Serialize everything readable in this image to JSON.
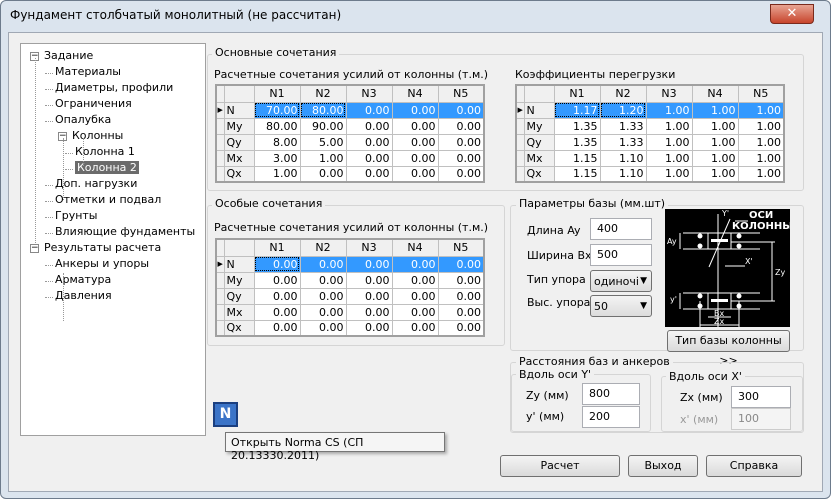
{
  "window": {
    "title": "Фундамент столбчатый монолитный (не рассчитан)",
    "close": "✕"
  },
  "tree": [
    {
      "label": "Задание",
      "level": 0,
      "expander": "−"
    },
    {
      "label": "Материалы",
      "level": 1
    },
    {
      "label": "Диаметры, профили",
      "level": 1
    },
    {
      "label": "Ограничения",
      "level": 1
    },
    {
      "label": "Опалубка",
      "level": 1
    },
    {
      "label": "Колонны",
      "level": 1,
      "expander": "−"
    },
    {
      "label": "Колонна 1",
      "level": 2
    },
    {
      "label": "Колонна 2",
      "level": 2,
      "selected": true
    },
    {
      "label": "Доп. нагрузки",
      "level": 1
    },
    {
      "label": "Отметки и подвал",
      "level": 1
    },
    {
      "label": "Грунты",
      "level": 1
    },
    {
      "label": "Влияющие фундаменты",
      "level": 1
    },
    {
      "label": "Результаты расчета",
      "level": 0,
      "expander": "−"
    },
    {
      "label": "Анкеры и упоры",
      "level": 1
    },
    {
      "label": "Арматура",
      "level": 1
    },
    {
      "label": "Давления",
      "level": 1
    }
  ],
  "main": {
    "group_title": "Основные сочетания",
    "forces_label": "Расчетные сочетания усилий от колонны (т.м.)",
    "overload_label": "Коэффициенты перегрузки",
    "columns": [
      "N1",
      "N2",
      "N3",
      "N4",
      "N5"
    ],
    "forces_rows": [
      {
        "label": "N",
        "values": [
          "70.00",
          "80.00",
          "0.00",
          "0.00",
          "0.00"
        ]
      },
      {
        "label": "My",
        "values": [
          "80.00",
          "90.00",
          "0.00",
          "0.00",
          "0.00"
        ]
      },
      {
        "label": "Qy",
        "values": [
          "8.00",
          "5.00",
          "0.00",
          "0.00",
          "0.00"
        ]
      },
      {
        "label": "Mx",
        "values": [
          "3.00",
          "1.00",
          "0.00",
          "0.00",
          "0.00"
        ]
      },
      {
        "label": "Qx",
        "values": [
          "1.00",
          "0.00",
          "0.00",
          "0.00",
          "0.00"
        ]
      }
    ],
    "overload_rows": [
      {
        "label": "N",
        "values": [
          "1.17",
          "1.20",
          "1.00",
          "1.00",
          "1.00"
        ]
      },
      {
        "label": "My",
        "values": [
          "1.35",
          "1.33",
          "1.00",
          "1.00",
          "1.00"
        ]
      },
      {
        "label": "Qy",
        "values": [
          "1.35",
          "1.33",
          "1.00",
          "1.00",
          "1.00"
        ]
      },
      {
        "label": "Mx",
        "values": [
          "1.15",
          "1.10",
          "1.00",
          "1.00",
          "1.00"
        ]
      },
      {
        "label": "Qx",
        "values": [
          "1.15",
          "1.10",
          "1.00",
          "1.00",
          "1.00"
        ]
      }
    ]
  },
  "special": {
    "group_title": "Особые сочетания",
    "forces_label": "Расчетные сочетания усилий от колонны (т.м.)",
    "rows": [
      {
        "label": "N",
        "values": [
          "0.00",
          "0.00",
          "0.00",
          "0.00",
          "0.00"
        ]
      },
      {
        "label": "My",
        "values": [
          "0.00",
          "0.00",
          "0.00",
          "0.00",
          "0.00"
        ]
      },
      {
        "label": "Qy",
        "values": [
          "0.00",
          "0.00",
          "0.00",
          "0.00",
          "0.00"
        ]
      },
      {
        "label": "Mx",
        "values": [
          "0.00",
          "0.00",
          "0.00",
          "0.00",
          "0.00"
        ]
      },
      {
        "label": "Qx",
        "values": [
          "0.00",
          "0.00",
          "0.00",
          "0.00",
          "0.00"
        ]
      }
    ]
  },
  "base": {
    "group_title": "Параметры базы (мм.шт)",
    "length_label": "Длина Ay",
    "length": "400",
    "width_label": "Ширина Bx",
    "width": "500",
    "stop_type_label": "Тип упора",
    "stop_type": "одиночі",
    "stop_height_label": "Выс. упора",
    "stop_height": "50",
    "diagram": {
      "title1": "ОСИ",
      "title2": "КОЛОННЫ",
      "ay": "Ay",
      "y_axis": "Y'",
      "x_axis": "X'",
      "zy": "Zy",
      "yp": "y'",
      "bx": "Bx",
      "zx": "Zx"
    },
    "type_button": "Тип базы  колонны >>"
  },
  "distances": {
    "group_title": "Расстояния баз и анкеров",
    "along_y": "Вдоль оси Y'",
    "zy_label": "Zy  (мм)",
    "zy": "800",
    "yp_label": "y'  (мм)",
    "yp": "200",
    "along_x": "Вдоль оси X'",
    "zx_label": "Zx  (мм)",
    "zx": "300",
    "xp_label": "x'  (мм)",
    "xp": "100"
  },
  "norma": {
    "icon_text": "N",
    "tooltip": "Открыть Norma CS (СП 20.13330.2011)"
  },
  "buttons": {
    "calc": "Расчет",
    "exit": "Выход",
    "help": "Справка"
  }
}
